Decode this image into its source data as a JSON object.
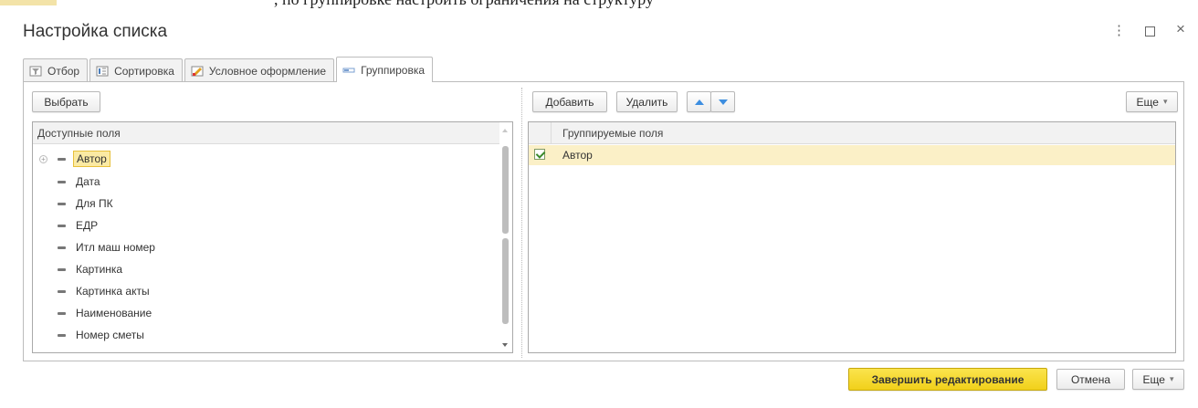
{
  "window": {
    "title": "Настройка списка",
    "more_glyph": "⋮",
    "close_glyph": "×"
  },
  "top_strip": {
    "clipped_text": ", по группировке настроить ограничения на структуру"
  },
  "tabs": [
    {
      "label": "Отбор",
      "icon": "filter-icon",
      "active": false
    },
    {
      "label": "Сортировка",
      "icon": "sort-icon",
      "active": false
    },
    {
      "label": "Условное оформление",
      "icon": "conditional-format-icon",
      "active": false
    },
    {
      "label": "Группировка",
      "icon": "grouping-icon",
      "active": true
    }
  ],
  "left_panel": {
    "select_button": "Выбрать",
    "header": "Доступные поля",
    "items": [
      {
        "label": "Автор",
        "expandable": true,
        "selected": true
      },
      {
        "label": "Дата",
        "expandable": false,
        "selected": false
      },
      {
        "label": "Для ПК",
        "expandable": false,
        "selected": false
      },
      {
        "label": "ЕДР",
        "expandable": false,
        "selected": false
      },
      {
        "label": "Итл маш номер",
        "expandable": false,
        "selected": false
      },
      {
        "label": "Картинка",
        "expandable": false,
        "selected": false
      },
      {
        "label": "Картинка акты",
        "expandable": false,
        "selected": false
      },
      {
        "label": "Наименование",
        "expandable": false,
        "selected": false
      },
      {
        "label": "Номер сметы",
        "expandable": false,
        "selected": false
      }
    ],
    "expander_glyph": "+"
  },
  "right_panel": {
    "add_button": "Добавить",
    "delete_button": "Удалить",
    "more_button": "Еще",
    "header": "Группируемые поля",
    "rows": [
      {
        "label": "Автор",
        "checked": true
      }
    ]
  },
  "footer": {
    "finish_button": "Завершить редактирование",
    "cancel_button": "Отмена",
    "more_button": "Еще",
    "caret": "▾"
  },
  "colors": {
    "primary_button": "#f1d01a",
    "selection": "#fbeaa3",
    "move_arrows": "#3d8ee0"
  }
}
